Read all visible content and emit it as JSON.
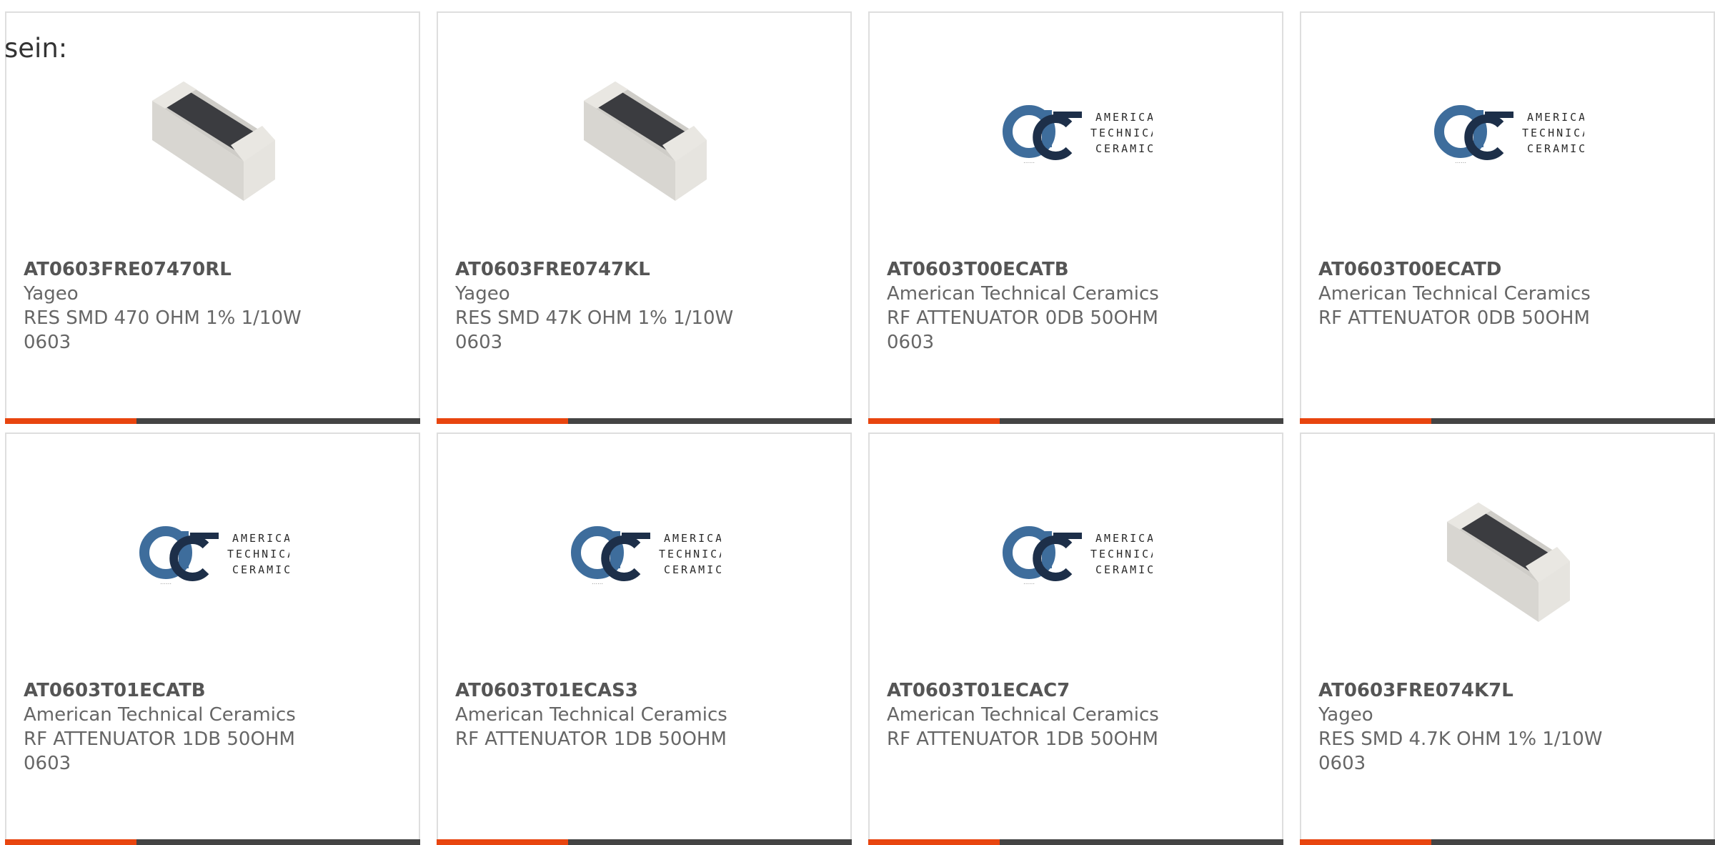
{
  "intro_text": "sein:",
  "accent_color": "#e8450f",
  "bar_color": "#444444",
  "logo": {
    "line1": "AMERICAN",
    "line2": "TECHNICAL",
    "line3": "CERAMICS"
  },
  "products": [
    {
      "part_number": "AT0603FRE07470RL",
      "manufacturer": "Yageo",
      "desc1": "RES SMD 470 OHM 1% 1/10W",
      "desc2": "0603",
      "image": "resistor-chip-image"
    },
    {
      "part_number": "AT0603FRE0747KL",
      "manufacturer": "Yageo",
      "desc1": "RES SMD 47K OHM 1% 1/10W",
      "desc2": "0603",
      "image": "resistor-chip-image"
    },
    {
      "part_number": "AT0603T00ECATB",
      "manufacturer": "American Technical Ceramics",
      "desc1": "RF ATTENUATOR 0DB 50OHM",
      "desc2": "0603",
      "image": "atc-logo"
    },
    {
      "part_number": "AT0603T00ECATD",
      "manufacturer": "American Technical Ceramics",
      "desc1": "RF ATTENUATOR 0DB 50OHM",
      "desc2": "",
      "image": "atc-logo"
    },
    {
      "part_number": "AT0603T01ECATB",
      "manufacturer": "American Technical Ceramics",
      "desc1": "RF ATTENUATOR 1DB 50OHM",
      "desc2": "0603",
      "image": "atc-logo"
    },
    {
      "part_number": "AT0603T01ECAS3",
      "manufacturer": "American Technical Ceramics",
      "desc1": "RF ATTENUATOR 1DB 50OHM",
      "desc2": "",
      "image": "atc-logo"
    },
    {
      "part_number": "AT0603T01ECAC7",
      "manufacturer": "American Technical Ceramics",
      "desc1": "RF ATTENUATOR 1DB 50OHM",
      "desc2": "",
      "image": "atc-logo"
    },
    {
      "part_number": "AT0603FRE074K7L",
      "manufacturer": "Yageo",
      "desc1": "RES SMD 4.7K OHM 1% 1/10W",
      "desc2": "0603",
      "image": "resistor-chip-image"
    }
  ]
}
